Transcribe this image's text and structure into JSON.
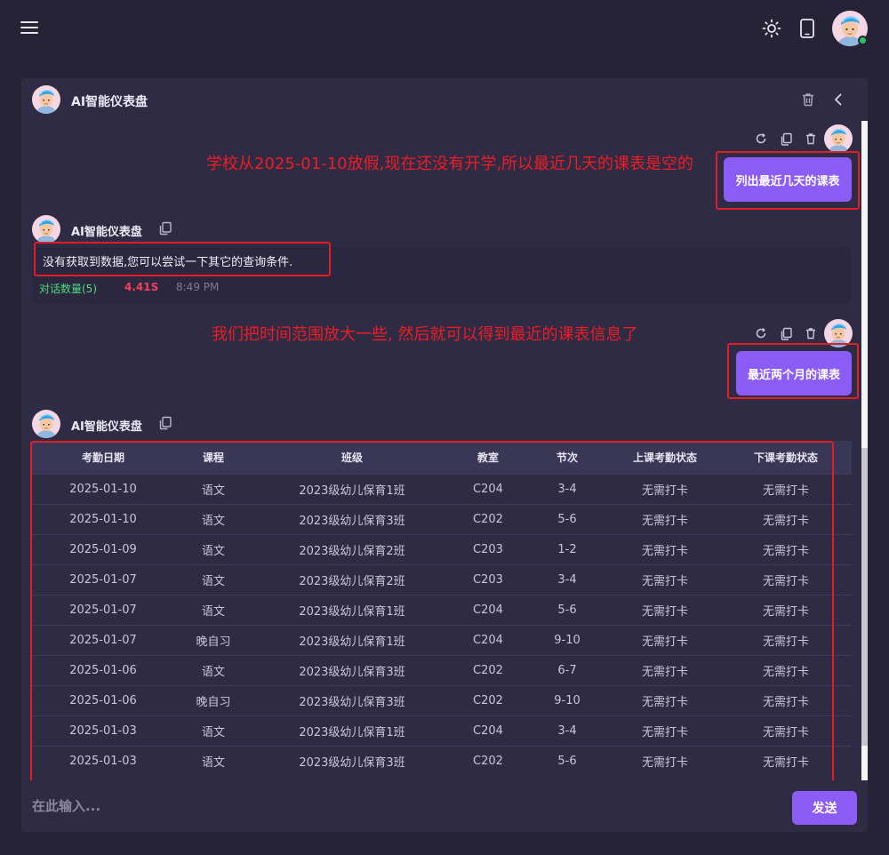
{
  "app": {
    "title": "AI智能仪表盘"
  },
  "icons": {
    "menu": "menu-icon",
    "theme": "sun-icon",
    "device": "phone-icon",
    "trash": "trash-icon",
    "back": "chevron-left-icon",
    "refresh": "refresh-icon",
    "copy": "copy-icon"
  },
  "colors": {
    "accent": "#8b5cf6",
    "annotation": "#ee1c24",
    "stat_count": "#4ade80",
    "stat_time": "#f43f5e"
  },
  "chat": {
    "user_message_1": "列出最近几天的课表",
    "user_message_2": "最近两个月的课表",
    "bot_name": "AI智能仪表盘",
    "bot_reply_1": "没有获取到数据,您可以尝试一下其它的查询条件.",
    "stats": {
      "count": "对话数量(5)",
      "duration": "4.41S",
      "time": "8:49 PM"
    }
  },
  "annotations": {
    "note_1": "学校从2025-01-10放假,现在还没有开学,所以最近几天的课表是空的",
    "note_2": "我们把时间范围放大一些, 然后就可以得到最近的课表信息了"
  },
  "table": {
    "headers": [
      "考勤日期",
      "课程",
      "班级",
      "教室",
      "节次",
      "上课考勤状态",
      "下课考勤状态"
    ],
    "rows": [
      [
        "2025-01-10",
        "语文",
        "2023级幼儿保育1班",
        "C204",
        "3-4",
        "无需打卡",
        "无需打卡"
      ],
      [
        "2025-01-10",
        "语文",
        "2023级幼儿保育3班",
        "C202",
        "5-6",
        "无需打卡",
        "无需打卡"
      ],
      [
        "2025-01-09",
        "语文",
        "2023级幼儿保育2班",
        "C203",
        "1-2",
        "无需打卡",
        "无需打卡"
      ],
      [
        "2025-01-07",
        "语文",
        "2023级幼儿保育2班",
        "C203",
        "3-4",
        "无需打卡",
        "无需打卡"
      ],
      [
        "2025-01-07",
        "语文",
        "2023级幼儿保育1班",
        "C204",
        "5-6",
        "无需打卡",
        "无需打卡"
      ],
      [
        "2025-01-07",
        "晚自习",
        "2023级幼儿保育1班",
        "C204",
        "9-10",
        "无需打卡",
        "无需打卡"
      ],
      [
        "2025-01-06",
        "语文",
        "2023级幼儿保育3班",
        "C202",
        "6-7",
        "无需打卡",
        "无需打卡"
      ],
      [
        "2025-01-06",
        "晚自习",
        "2023级幼儿保育3班",
        "C202",
        "9-10",
        "无需打卡",
        "无需打卡"
      ],
      [
        "2025-01-03",
        "语文",
        "2023级幼儿保育1班",
        "C204",
        "3-4",
        "无需打卡",
        "无需打卡"
      ],
      [
        "2025-01-03",
        "语文",
        "2023级幼儿保育3班",
        "C202",
        "5-6",
        "无需打卡",
        "无需打卡"
      ]
    ]
  },
  "input": {
    "placeholder": "在此输入...",
    "send_label": "发送"
  }
}
